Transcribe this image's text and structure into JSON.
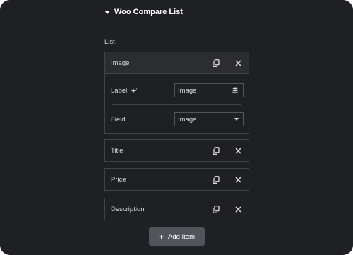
{
  "section": {
    "title": "Woo Compare List"
  },
  "list": {
    "label": "List",
    "items": [
      {
        "title": "Image",
        "expanded": true,
        "fields": {
          "label_text": "Label",
          "label_value": "Image",
          "field_text": "Field",
          "field_value": "Image"
        }
      },
      {
        "title": "Title"
      },
      {
        "title": "Price"
      },
      {
        "title": "Description"
      }
    ],
    "add_label": "Add Item"
  },
  "icons": {
    "duplicate": "copy-icon",
    "remove": "close-icon",
    "ai": "sparkle-icon",
    "dynamic": "database-icon"
  },
  "colors": {
    "panel_bg": "#1f2023",
    "item_open_bg": "#2b2d31",
    "border": "#3f444b",
    "button_bg": "#50555c",
    "text": "#d5d8dc"
  }
}
